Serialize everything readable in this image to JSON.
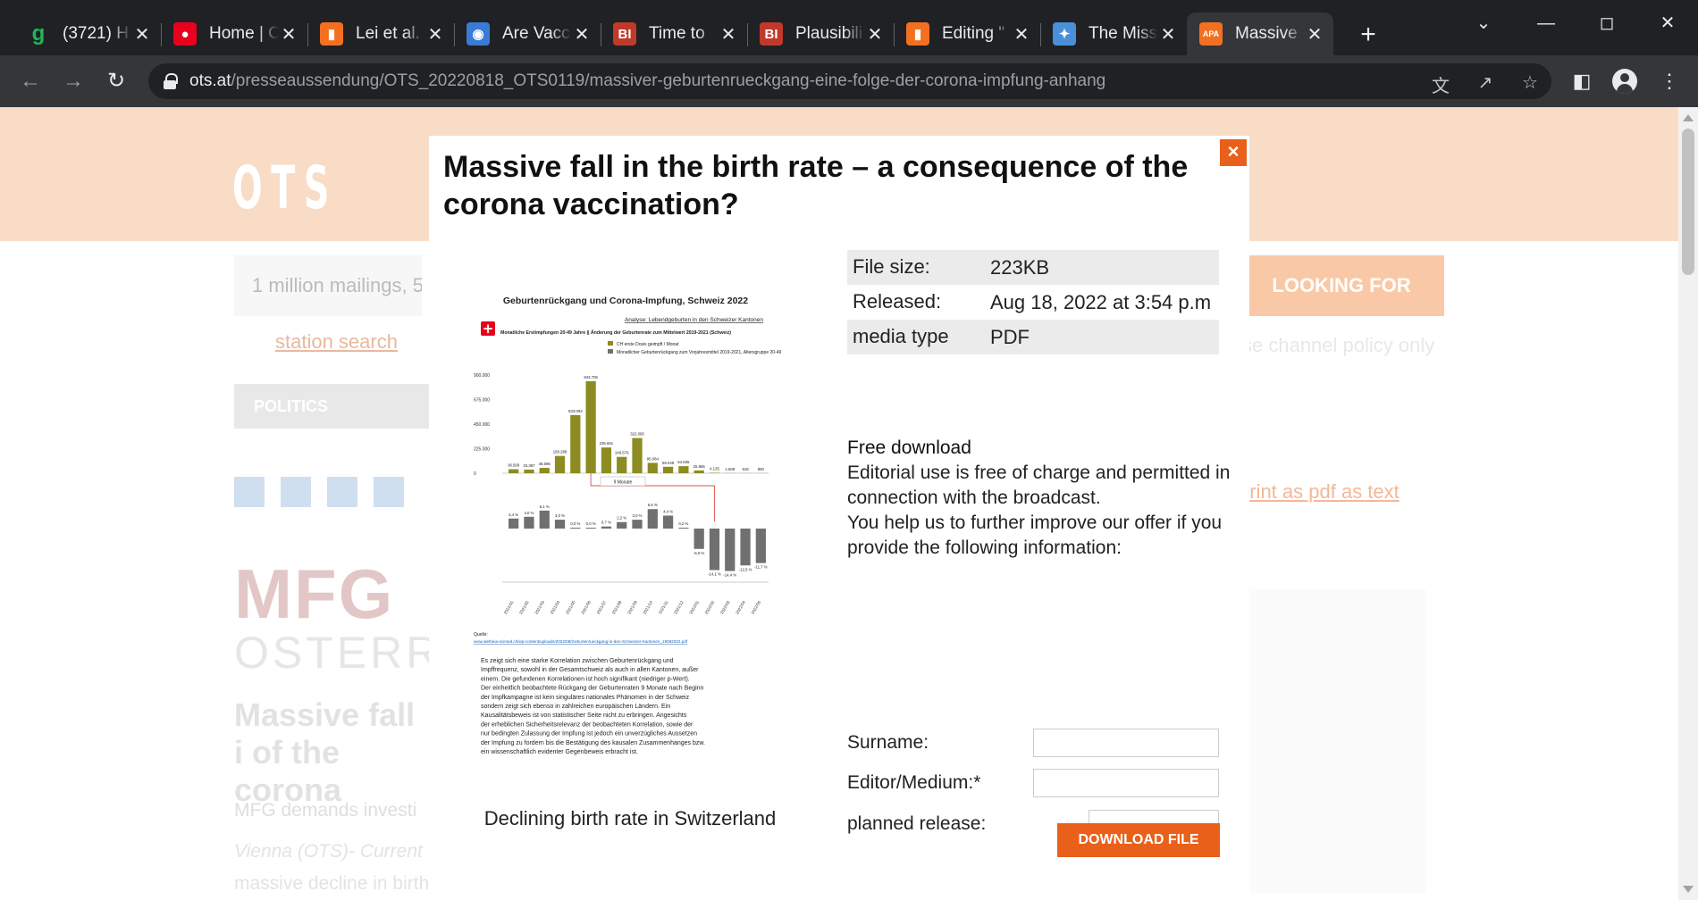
{
  "browser": {
    "tabs": [
      {
        "title": "(3721) H",
        "favicon": "g",
        "favicon_color": "#1db954"
      },
      {
        "title": "Home | C",
        "favicon": "mic",
        "favicon_color": "#e8001c"
      },
      {
        "title": "Lei et al.",
        "favicon": "bookmark",
        "favicon_color": "#f37021"
      },
      {
        "title": "Are Vacc",
        "favicon": "globe",
        "favicon_color": "#3a7bd5"
      },
      {
        "title": "Time to",
        "favicon": "BI",
        "favicon_color": "#c0392b"
      },
      {
        "title": "Plausibili",
        "favicon": "BI",
        "favicon_color": "#c0392b"
      },
      {
        "title": "Editing \"",
        "favicon": "bookmark",
        "favicon_color": "#f37021"
      },
      {
        "title": "The Miss",
        "favicon": "bolt",
        "favicon_color": "#4a90d9"
      },
      {
        "title": "Massive",
        "favicon": "apa",
        "favicon_color": "#f37021"
      }
    ],
    "url_host": "ots.at",
    "url_path": "/presseaussendung/OTS_20220818_OTS0119/massiver-geburtenrueckgang-eine-folge-der-corona-impfung-anhang"
  },
  "page": {
    "logo": "OTS",
    "search_placeholder": "1 million mailings, 5",
    "looking_for": "LOOKING FOR",
    "station_search": "station search",
    "channel_policy": "se channel policy only",
    "politics": "POLITICS",
    "print_links": "print as pdf as text",
    "org_logo_line1": "MFG",
    "org_logo_line2": "OSTERREIC",
    "bg_title": "Massive fall i of the corona",
    "bg_subtitle": "MFG demands investi",
    "bg_dateline": "Vienna (OTS)- Current",
    "bg_body": "massive decline in births in the first five months of this year. In Germany the"
  },
  "modal": {
    "title": "Massive fall in the birth rate – a consequence of the corona vaccination?",
    "close_label": "×",
    "caption": "Declining birth rate in Switzerland",
    "meta": [
      {
        "key": "File size:",
        "value": "223KB"
      },
      {
        "key": "Released:",
        "value": "Aug 18, 2022 at 3:54 p.m"
      },
      {
        "key": "media type",
        "value": "PDF"
      }
    ],
    "free_download_heading": "Free download",
    "free_download_text": "Editorial use is free of charge and permitted in connection with the broadcast.",
    "help_text": "You help us to further improve our offer if you provide the following information:",
    "form": {
      "surname_label": "Surname:",
      "editor_label": "Editor/Medium:*",
      "release_label": "planned release:"
    },
    "download_button": "DOWNLOAD FILE"
  },
  "preview_doc": {
    "title": "Geburtenrückgang und Corona-Impfung, Schweiz 2022",
    "analysis": "Analyse: Lebendgeburten in den Schweizer Kantonen",
    "subtitle": "Monatliche Erstimpfungen 20-49 Jahre || Änderung der Geburtenrate zum Mittelwert 2019-2021 (Schweiz)",
    "legend_1": "CH erste Dosis geimpft / Monat",
    "legend_2": "Monatlicher Geburtenrückgang zum Vorjahresmittel 2019-2021, Altersgruppe 20-49",
    "lag_label": "9 Monate",
    "source_label": "Quelle:",
    "source_url": "www.aletheia-scimed.ch/wp-content/uploads/2022/08/Geburtenrueckgang-in-den-Schweizer-Kantonen_19082022.pdf",
    "body": "Es zeigt sich eine starke Korrelation zwischen Geburtenrückgang und Impffrequenz, sowohl in der Gesamtschweiz als auch in allen Kantonen, außer einem. Die gefundenen Korrelationen ist hoch signifikant (niedriger p-Wert). Der einheitlich beobachtete Rückgang der Geburtenraten 9 Monate nach Beginn der Impfkampagne ist kein singuläres nationales Phänomen in der Schweiz sondern zeigt sich ebenso in zahlreichen europäischen Ländern. Ein Kausalitätsbeweis ist von statistischer Seite nicht zu erbringen. Angesichts der erheblichen Sicherheitsrelevanz der beobachteten Korrelation, sowie der nur bedingten Zulassung der Impfung ist jedoch ein unverzügliches Aussetzen der Impfung zu fordern bis die Bestätigung des kausalen Zusammenhanges bzw. ein wissenschaftlich evidenter Gegenbeweis erbracht ist."
  },
  "chart_data": {
    "type": "bar",
    "title": "Geburtenrückgang und Corona-Impfung, Schweiz 2022",
    "y_ticks": [
      "900.000",
      "675.000",
      "450.000",
      "225.000",
      "0"
    ],
    "ylim": [
      0,
      900000
    ],
    "months": [
      "2021/01",
      "2021/02",
      "2021/03",
      "2021/04",
      "2021/05",
      "2021/06",
      "2021/07",
      "2021/08",
      "2021/09",
      "2021/10",
      "2021/11",
      "2021/12",
      "2022/01",
      "2022/02",
      "2022/03",
      "2022/04",
      "2022/05"
    ],
    "series": [
      {
        "name": "CH erste Dosis geimpft / Monat",
        "values": [
          36568,
          33387,
          48696,
          158288,
          533093,
          843706,
          235661,
          149579,
          322095,
          95084,
          59049,
          64835,
          25865,
          4135,
          1608,
          918,
          850
        ],
        "labels": [
          "36.568",
          "33.387",
          "48.696",
          "158.288",
          "533.093",
          "843.706",
          "235.661",
          "149.579",
          "322.095",
          "95.084",
          "59.049",
          "64.835",
          "25.865",
          "4.135",
          "1.608",
          "918",
          "850"
        ],
        "color": "#8c8c22"
      },
      {
        "name": "Monatlicher Geburtenrückgang zum Vorjahresmittel 2019-2021, Altersgruppe 20-49",
        "values": [
          3.4,
          4.0,
          6.1,
          3.0,
          0.0,
          0.0,
          0.7,
          2.2,
          3.0,
          6.6,
          4.4,
          0.2,
          -6.9,
          -14.1,
          -14.4,
          -12.5,
          -11.7
        ],
        "labels": [
          "3,4 %",
          "4,0 %",
          "6,1 %",
          "3,0 %",
          "0,0 %",
          "0,0 %",
          "0,7 %",
          "2,2 %",
          "3,0 %",
          "6,6 %",
          "4,4 %",
          "0,2 %",
          "-6,9 %",
          "-14,1 %",
          "-14,4 %",
          "-12,5 %",
          "-11,7 %"
        ],
        "color": "#707070"
      }
    ]
  }
}
